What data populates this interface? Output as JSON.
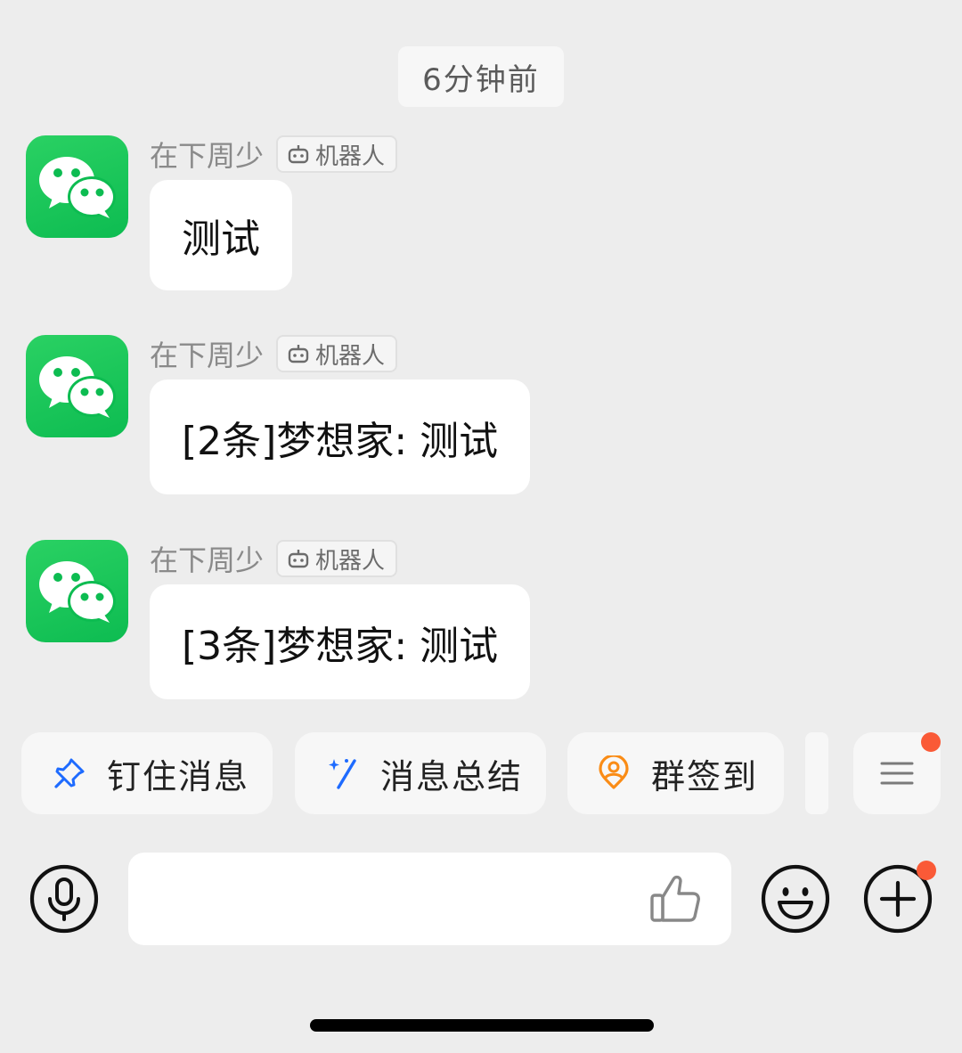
{
  "timestamp": "6分钟前",
  "messages": [
    {
      "sender": "在下周少",
      "tag": "机器人",
      "text": "测试"
    },
    {
      "sender": "在下周少",
      "tag": "机器人",
      "text": "[2条]梦想家: 测试"
    },
    {
      "sender": "在下周少",
      "tag": "机器人",
      "text": "[3条]梦想家: 测试"
    }
  ],
  "quick_actions": [
    {
      "label": "钉住消息",
      "icon": "pin-icon"
    },
    {
      "label": "消息总结",
      "icon": "magic-wand-icon"
    },
    {
      "label": "群签到",
      "icon": "location-person-icon"
    }
  ],
  "input": {
    "placeholder": "",
    "value": ""
  },
  "icons": {
    "avatar": "wechat-logo-icon",
    "voice": "microphone-icon",
    "like": "thumbs-up-icon",
    "emoji": "smiley-icon",
    "more": "plus-icon",
    "menu": "menu-icon"
  },
  "colors": {
    "background": "#EDEDED",
    "bubble": "#FFFFFF",
    "wechat_green": "#07C160",
    "blue_accent": "#1E6BFF",
    "orange_accent": "#FA8C16",
    "badge_red": "#FA5A37"
  }
}
